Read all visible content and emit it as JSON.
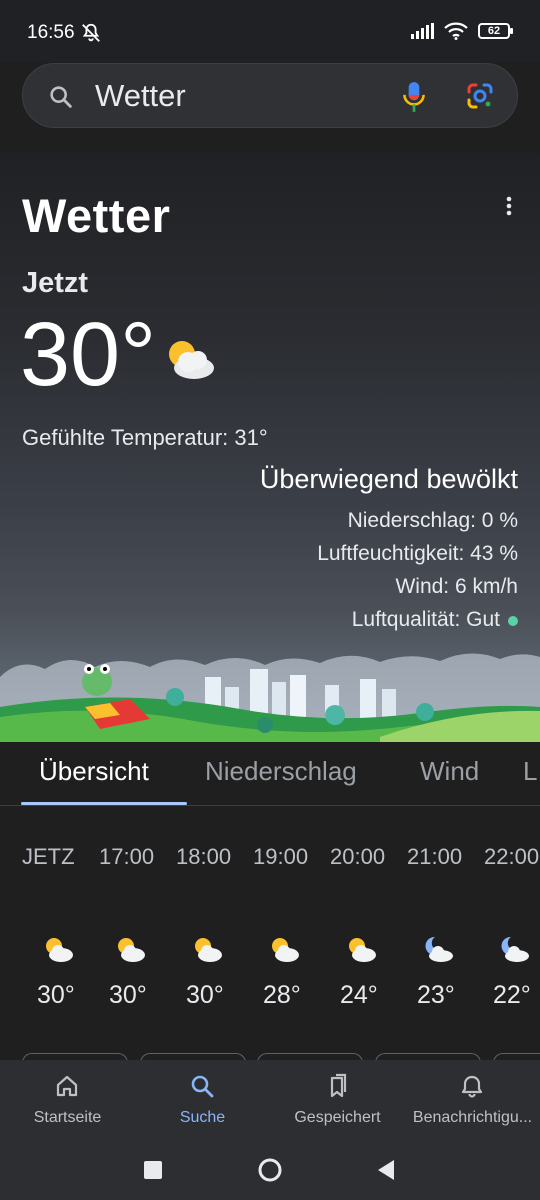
{
  "status_bar": {
    "time": "16:56",
    "battery": "62",
    "icons": [
      "mute-icon",
      "signal-icon",
      "wifi-icon",
      "battery-icon"
    ]
  },
  "search": {
    "query": "Wetter",
    "icons": [
      "search-icon",
      "mic-icon",
      "lens-icon"
    ]
  },
  "weather": {
    "title": "Wetter",
    "now_label": "Jetzt",
    "temperature": "30°",
    "feels_like": "Gefühlte Temperatur: 31°",
    "condition": "Überwiegend bewölkt",
    "precipitation": "Niederschlag: 0 %",
    "humidity": "Luftfeuchtigkeit: 43 %",
    "wind": "Wind: 6 km/h",
    "air_quality": "Luftqualität: Gut",
    "air_quality_color": "#5bd1a6"
  },
  "tabs": [
    {
      "label": "Übersicht"
    },
    {
      "label": "Niederschlag"
    },
    {
      "label": "Wind"
    },
    {
      "label": "L"
    }
  ],
  "hourly": [
    {
      "time": "JETZ",
      "temp": "30°",
      "icon": "partly-cloudy-icon"
    },
    {
      "time": "17:00",
      "temp": "30°",
      "icon": "partly-cloudy-icon"
    },
    {
      "time": "18:00",
      "temp": "30°",
      "icon": "partly-cloudy-icon"
    },
    {
      "time": "19:00",
      "temp": "28°",
      "icon": "partly-cloudy-icon"
    },
    {
      "time": "20:00",
      "temp": "24°",
      "icon": "partly-cloudy-icon"
    },
    {
      "time": "21:00",
      "temp": "23°",
      "icon": "night-cloudy-icon"
    },
    {
      "time": "22:00",
      "temp": "22°",
      "icon": "night-cloudy-icon"
    }
  ],
  "bottom_nav": [
    {
      "label": "Startseite",
      "icon": "home-icon"
    },
    {
      "label": "Suche",
      "icon": "search-icon"
    },
    {
      "label": "Gespeichert",
      "icon": "bookmarks-icon"
    },
    {
      "label": "Benachrichtigu...",
      "icon": "bell-icon"
    }
  ],
  "colors": {
    "accent": "#8ab4f8",
    "background": "#1f1f1f"
  }
}
